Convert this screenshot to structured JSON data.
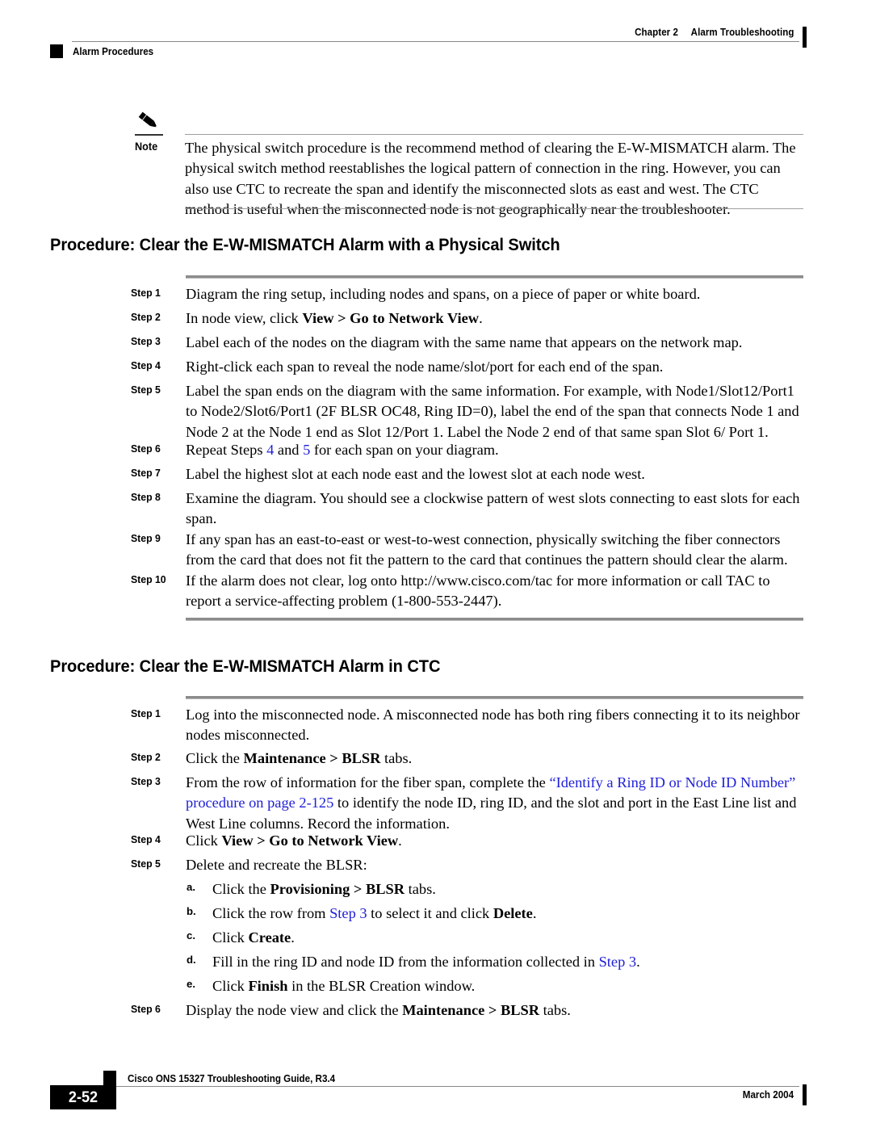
{
  "header": {
    "chapter": "Chapter 2",
    "chapter_title": "Alarm Troubleshooting",
    "section": "Alarm Procedures"
  },
  "note": {
    "icon": "pencil-icon",
    "label": "Note",
    "text": "The physical switch procedure is the recommend method of clearing the E-W-MISMATCH alarm. The physical switch method reestablishes the logical pattern of connection in the ring. However, you can also use CTC to recreate the span and identify the misconnected slots as east and west. The CTC method is useful when the misconnected node is not geographically near the troubleshooter."
  },
  "procedures": [
    {
      "heading": "Procedure: Clear the E-W-MISMATCH Alarm with a Physical Switch",
      "steps": [
        {
          "label": "Step 1",
          "text": "Diagram the ring setup, including nodes and spans, on a piece of paper or white board."
        },
        {
          "label": "Step 2",
          "text": "In node view, click View > Go to Network View."
        },
        {
          "label": "Step 3",
          "text": "Label each of the nodes on the diagram with the same name that appears on the network map."
        },
        {
          "label": "Step 4",
          "text": "Right-click each span to reveal the node name/slot/port for each end of the span."
        },
        {
          "label": "Step 5",
          "text": "Label the span ends on the diagram with the same information. For example, with Node1/Slot12/Port1 to Node2/Slot6/Port1 (2F BLSR OC48, Ring ID=0), label the end of the span that connects Node 1 and Node 2 at the Node 1 end as Slot 12/Port 1. Label the Node 2 end of that same span Slot 6/ Port 1."
        },
        {
          "label": "Step 6",
          "text": "Repeat Steps 4 and 5 for each span on your diagram."
        },
        {
          "label": "Step 7",
          "text": "Label the highest slot at each node east and the lowest slot at each node west."
        },
        {
          "label": "Step 8",
          "text": "Examine the diagram. You should see a clockwise pattern of west slots connecting to east slots for each span."
        },
        {
          "label": "Step 9",
          "text": "If any span has an east-to-east or west-to-west connection, physically switching the fiber connectors from the card that does not fit the pattern to the card that continues the pattern should clear the alarm."
        },
        {
          "label": "Step 10",
          "text": "If the alarm does not clear, log onto http://www.cisco.com/tac for more information or call TAC to report a service-affecting problem (1-800-553-2447)."
        }
      ]
    },
    {
      "heading": "Procedure: Clear the E-W-MISMATCH Alarm in CTC",
      "steps": [
        {
          "label": "Step 1",
          "text": "Log into the misconnected node. A misconnected node has both ring fibers connecting it to its neighbor nodes misconnected."
        },
        {
          "label": "Step 2",
          "text": "Click the Maintenance > BLSR tabs."
        },
        {
          "label": "Step 3",
          "text": "From the row of information for the fiber span, complete the “Identify a Ring ID or Node ID Number” procedure on page 2-125 to identify the node ID, ring ID, and the slot and port in the East Line list and West Line columns. Record the information."
        },
        {
          "label": "Step 4",
          "text": "Click View > Go to Network View."
        },
        {
          "label": "Step 5",
          "text": "Delete and recreate the BLSR:"
        },
        {
          "label": "Step 6",
          "text": "Display the node view and click the Maintenance > BLSR tabs."
        }
      ],
      "substeps": [
        {
          "label": "a.",
          "text": "Click the Provisioning > BLSR tabs."
        },
        {
          "label": "b.",
          "text": "Click the row from Step 3 to select it and click Delete."
        },
        {
          "label": "c.",
          "text": "Click Create."
        },
        {
          "label": "d.",
          "text": "Fill in the ring ID and node ID from the information collected in Step 3."
        },
        {
          "label": "e.",
          "text": "Click Finish in the BLSR Creation window."
        }
      ]
    }
  ],
  "links": {
    "step4_ref": "4",
    "step5_ref": "5",
    "step3_ref": "Step 3",
    "xref_title": "“Identify a Ring ID or Node ID Number”",
    "xref_page": "procedure on page 2-125"
  },
  "footer": {
    "guide": "Cisco ONS 15327 Troubleshooting Guide, R3.4",
    "page_number": "2-52",
    "date": "March 2004"
  },
  "colors": {
    "link": "#2020d8",
    "rule": "#8c8c8c",
    "text": "#000000"
  }
}
